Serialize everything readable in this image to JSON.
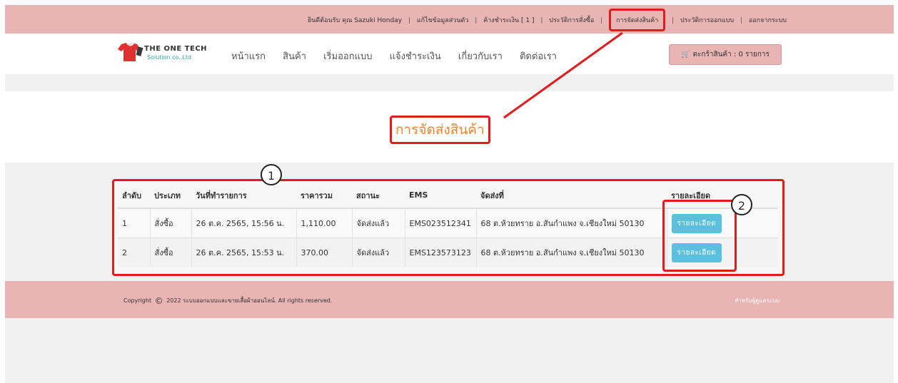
{
  "topbar": {
    "links": [
      "ยินดีต้อนรับ คุณ Sazuki Honday",
      "แก้ไขข้อมูลส่วนตัว",
      "ค้างชำระเงิน [ 1 ]",
      "ประวัติการสั่งซื้อ",
      "การจัดส่งสินค้า",
      "ประวัติการออกแบบ",
      "ออกจากระบบ"
    ],
    "separator": "|"
  },
  "logo": {
    "line1": "THE ONE TECH",
    "line2": "Solution co.,Ltd"
  },
  "nav": {
    "items": [
      "หน้าแรก",
      "สินค้า",
      "เริ่มออกแบบ",
      "แจ้งชำระเงิน",
      "เกี่ยวกับเรา",
      "ติดต่อเรา"
    ]
  },
  "cart": {
    "label": "ตะกร้าสินค้า : 0 รายการ"
  },
  "page": {
    "title": "การจัดส่งสินค้า"
  },
  "annotations": {
    "table_badge": "1",
    "detail_badge": "2"
  },
  "table": {
    "headers": [
      "ลำดับ",
      "ประเภท",
      "วันที่ทำรายการ",
      "ราคารวม",
      "สถานะ",
      "EMS",
      "จัดส่งที่",
      "รายละเอียด"
    ],
    "rows": [
      {
        "no": "1",
        "type": "สั่งซื้อ",
        "date": "26 ต.ค. 2565, 15:56 น.",
        "total": "1,110.00",
        "status": "จัดส่งแล้ว",
        "ems": "EMS023512341",
        "address": "68 ต.ห้วยทราย อ.สันกำแพง จ.เชียงใหม่ 50130",
        "detail": "รายละเอียด"
      },
      {
        "no": "2",
        "type": "สั่งซื้อ",
        "date": "26 ต.ค. 2565, 15:53 น.",
        "total": "370.00",
        "status": "จัดส่งแล้ว",
        "ems": "EMS123573123",
        "address": "68 ต.ห้วยทราย อ.สันกำแพง จ.เชียงใหม่ 50130",
        "detail": "รายละเอียด"
      }
    ]
  },
  "footer": {
    "copyright_pre": "Copyright",
    "copyright_symbol": "©",
    "copyright_post": "2022 ระบบออกแบบและขายเสื้อผ้าออนไลน์. All rights reserved.",
    "admin": "สำหรับผู้ดูแลระบบ"
  },
  "colors": {
    "accent": "#e8b4b4",
    "highlight": "#e21c1c",
    "title": "#f0852d",
    "button": "#5bc0de"
  },
  "icons": {
    "cart": "cart-icon",
    "logo": "shirt-logo-icon"
  }
}
